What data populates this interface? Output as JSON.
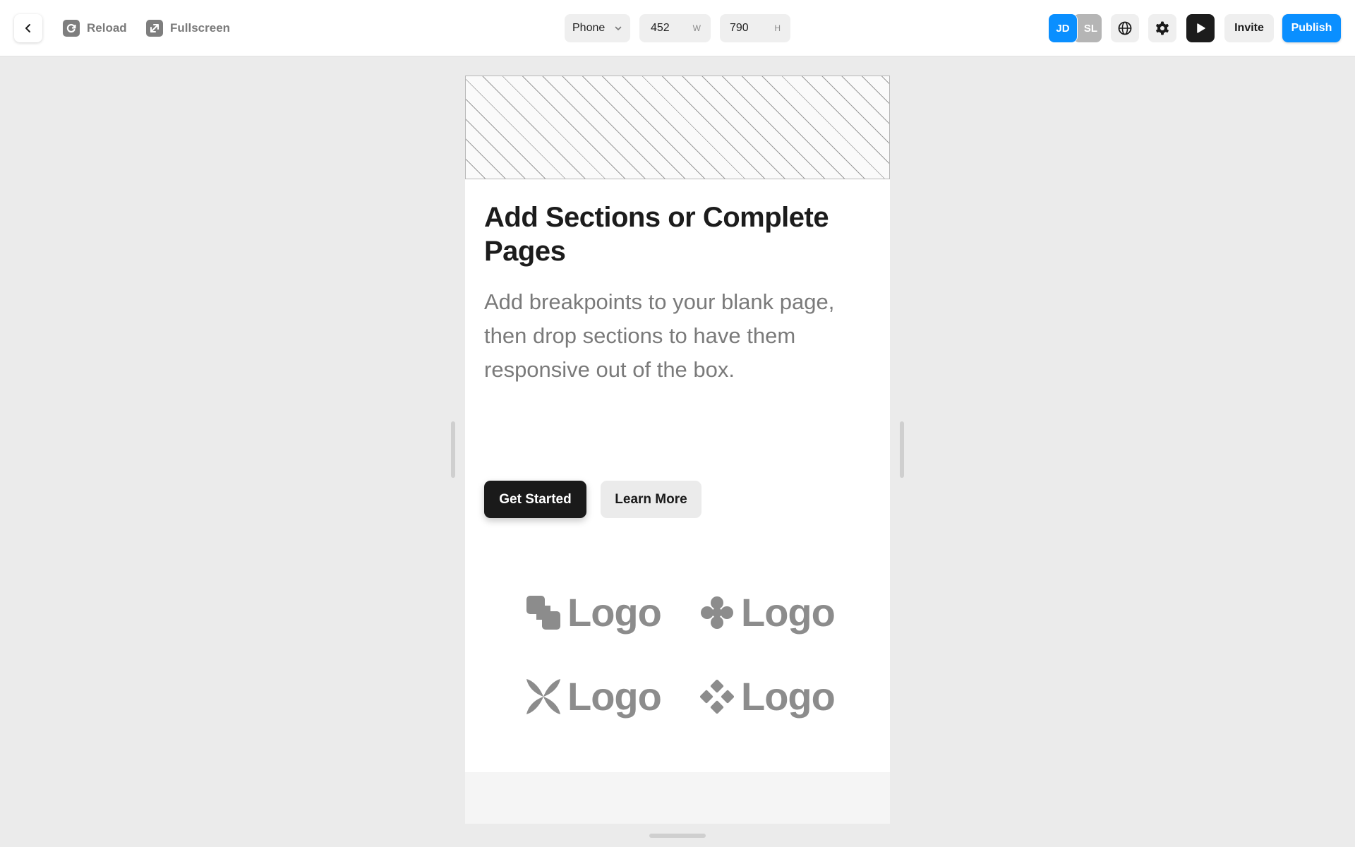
{
  "toolbar": {
    "reload_label": "Reload",
    "fullscreen_label": "Fullscreen",
    "device": "Phone",
    "width_value": "452",
    "width_unit": "W",
    "height_value": "790",
    "height_unit": "H",
    "avatars": [
      {
        "initials": "JD",
        "color": "#0a8fff"
      },
      {
        "initials": "SL",
        "color": "#b5b5b5"
      }
    ],
    "invite_label": "Invite",
    "publish_label": "Publish",
    "icons": {
      "back": "chevron-left-icon",
      "reload": "reload-icon",
      "fullscreen": "expand-icon",
      "device_dropdown": "chevron-down-icon",
      "language": "globe-icon",
      "settings": "gear-icon",
      "preview": "play-icon"
    }
  },
  "preview": {
    "headline": "Add Sections or Complete Pages",
    "subtext": "Add breakpoints to your blank page, then drop sections to have them responsive out of the box.",
    "primary_button": "Get Started",
    "secondary_button": "Learn More",
    "logos": [
      {
        "label": "Logo",
        "icon": "squares-logo-icon"
      },
      {
        "label": "Logo",
        "icon": "clover-logo-icon"
      },
      {
        "label": "Logo",
        "icon": "petal-logo-icon"
      },
      {
        "label": "Logo",
        "icon": "diamond-logo-icon"
      }
    ]
  },
  "colors": {
    "accent": "#0a8fff",
    "dark": "#1a1a1a",
    "canvas_bg": "#ebebeb"
  }
}
